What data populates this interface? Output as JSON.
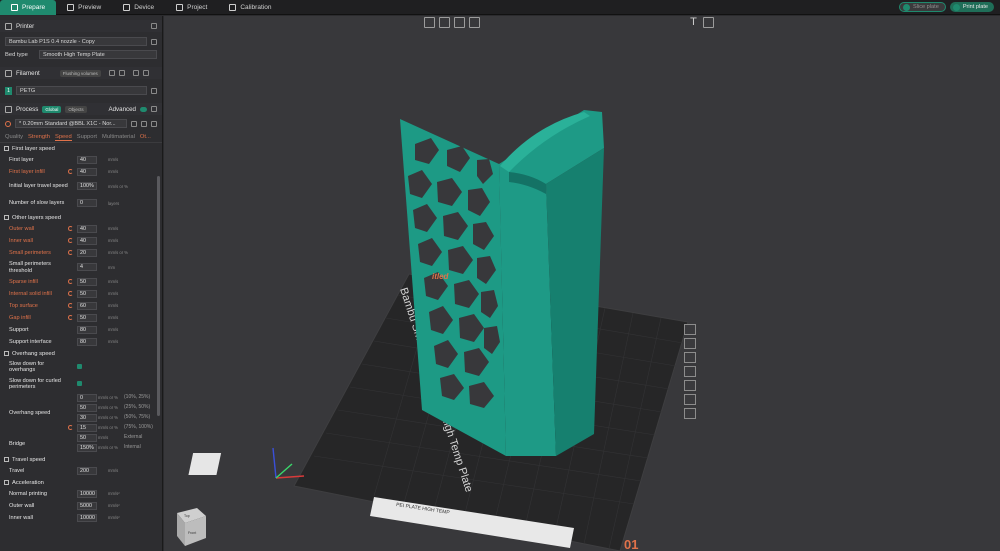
{
  "topbar": {
    "tabs": [
      {
        "label": "Prepare",
        "active": true
      },
      {
        "label": "Preview"
      },
      {
        "label": "Device"
      },
      {
        "label": "Project"
      },
      {
        "label": "Calibration"
      }
    ],
    "slice_label": "Slice plate",
    "print_label": "Print plate"
  },
  "printer": {
    "header": "Printer",
    "name": "Bambu Lab P1S 0.4 nozzle - Copy",
    "bed_type_label": "Bed type",
    "bed_type_value": "Smooth High Temp Plate"
  },
  "filament": {
    "header": "Filament",
    "flush_label": "Flushing volumes",
    "slot_number": "1",
    "material": "PETG"
  },
  "process": {
    "header": "Process",
    "global_label": "Global",
    "objects_label": "Objects",
    "advanced_label": "Advanced",
    "profile": "* 0.20mm Standard @BBL X1C - Nor..."
  },
  "subtabs": [
    "Quality",
    "Strength",
    "Speed",
    "Support",
    "Multimaterial",
    "Ot..."
  ],
  "groups": {
    "first_layer": "First layer speed",
    "other_layers": "Other layers speed",
    "overhang": "Overhang speed",
    "travel": "Travel speed",
    "acceleration": "Acceleration"
  },
  "params_first": [
    {
      "label": "First layer",
      "value": "40",
      "unit": "mm/s",
      "mod": false
    },
    {
      "label": "First layer infill",
      "value": "40",
      "unit": "mm/s",
      "mod": true
    },
    {
      "label": "Initial layer travel speed",
      "value": "100%",
      "unit": "mm/s or %",
      "mod": false
    },
    {
      "label": "Number of slow layers",
      "value": "0",
      "unit": "layers",
      "mod": false
    }
  ],
  "params_other": [
    {
      "label": "Outer wall",
      "value": "40",
      "unit": "mm/s",
      "mod": true
    },
    {
      "label": "Inner wall",
      "value": "40",
      "unit": "mm/s",
      "mod": true
    },
    {
      "label": "Small perimeters",
      "value": "20",
      "unit": "mm/s or %",
      "mod": true
    },
    {
      "label": "Small perimeters threshold",
      "value": "4",
      "unit": "mm",
      "mod": false
    },
    {
      "label": "Sparse infill",
      "value": "50",
      "unit": "mm/s",
      "mod": true
    },
    {
      "label": "Internal solid infill",
      "value": "50",
      "unit": "mm/s",
      "mod": true
    },
    {
      "label": "Top surface",
      "value": "60",
      "unit": "mm/s",
      "mod": true
    },
    {
      "label": "Gap infill",
      "value": "50",
      "unit": "mm/s",
      "mod": true
    },
    {
      "label": "Support",
      "value": "80",
      "unit": "mm/s",
      "mod": false
    },
    {
      "label": "Support interface",
      "value": "80",
      "unit": "mm/s",
      "mod": false
    }
  ],
  "overhang": {
    "slow_down_label": "Slow down for overhangs",
    "curled_label": "Slow down for curled perimeters",
    "speed_label": "Overhang speed",
    "rows": [
      {
        "value": "0",
        "unit": "mm/s or %",
        "range": "(10%, 25%)"
      },
      {
        "value": "50",
        "unit": "mm/s or %",
        "range": "(25%, 50%)"
      },
      {
        "value": "30",
        "unit": "mm/s or %",
        "range": "(50%, 75%)"
      },
      {
        "value": "15",
        "unit": "mm/s or %",
        "range": "(75%, 100%)"
      }
    ],
    "bridge_label": "Bridge",
    "bridge_rows": [
      {
        "value": "50",
        "unit": "mm/s",
        "range": "External"
      },
      {
        "value": "150%",
        "unit": "mm/s or %",
        "range": "Internal"
      }
    ]
  },
  "travel": {
    "label": "Travel",
    "value": "200",
    "unit": "mm/s"
  },
  "acceleration": [
    {
      "label": "Normal printing",
      "value": "10000",
      "unit": "mm/s²"
    },
    {
      "label": "Outer wall",
      "value": "5000",
      "unit": "mm/s²"
    },
    {
      "label": "Inner wall",
      "value": "10000",
      "unit": "mm/s²"
    }
  ],
  "viewport": {
    "plate_label": "Bambu Smooth PEI Plate | High Temp Plate",
    "plate_number": "01",
    "model_label": "itled",
    "cube_top": "Top",
    "cube_front": "Front",
    "bottom_label": "PEI PLATE HIGH TEMP",
    "colors": {
      "model": "#1e9a86",
      "accent": "#1f8a6e",
      "bed": "#2a2a2b",
      "modified": "#e0724a"
    }
  }
}
